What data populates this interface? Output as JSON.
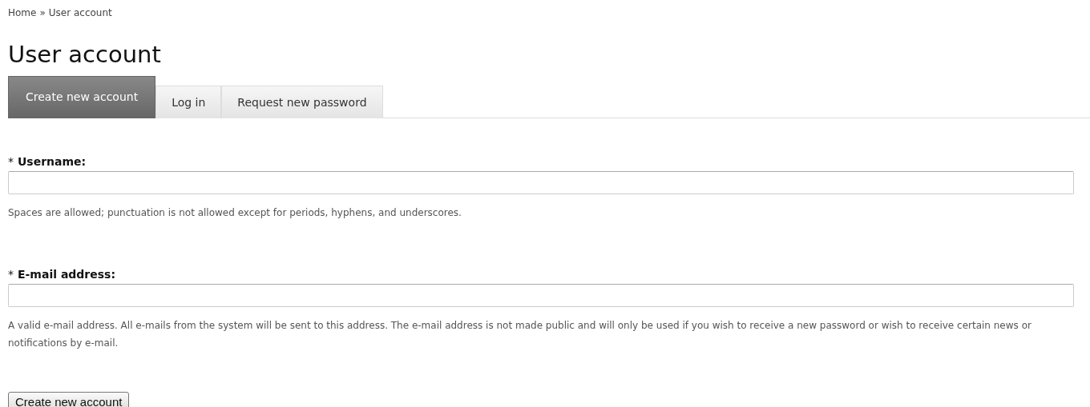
{
  "breadcrumb": {
    "items": [
      "Home",
      "User account"
    ],
    "separator": "»"
  },
  "title": "User account",
  "tabs": [
    {
      "label": "Create new account",
      "selected": true
    },
    {
      "label": "Log in",
      "selected": false
    },
    {
      "label": "Request new password",
      "selected": false
    }
  ],
  "fields": [
    {
      "required_mark": "*",
      "label": "Username:",
      "description": "Spaces are allowed; punctuation is not allowed except for periods, hyphens, and underscores."
    },
    {
      "required_mark": "*",
      "label": "E-mail address:",
      "description": "A valid e-mail address. All e-mails from the system will be sent to this address. The e-mail address is not made public and will only be used if you wish to receive a new password or wish to receive certain news or notifications by e-mail."
    }
  ],
  "submit": "Create new account"
}
